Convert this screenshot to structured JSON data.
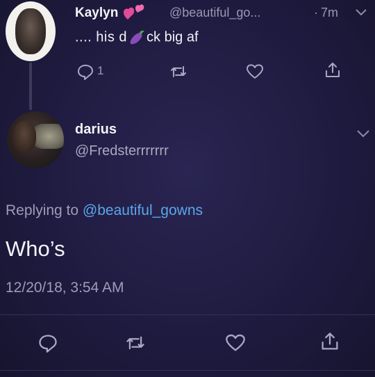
{
  "tweet_top": {
    "name": "Kaylyn",
    "handle": "@beautiful_go...",
    "separator": "·",
    "time": "7m",
    "text_before": ".... his d",
    "text_after": "ck big af",
    "reply_count": "1"
  },
  "tweet_main": {
    "name": "darius",
    "handle": "@Fredsterrrrrrr",
    "replying_prefix": "Replying to",
    "replying_to": "@beautiful_gowns",
    "text": "Who’s",
    "timestamp": "12/20/18, 3:54 AM"
  },
  "icons": [
    "reply-icon",
    "retweet-icon",
    "like-icon",
    "share-icon",
    "chevron-down-icon",
    "two-hearts-emoji",
    "eggplant-emoji"
  ],
  "colors": {
    "background": "#1f1b40",
    "link": "#5aa7ea",
    "secondary_text": "#9a98b4",
    "icon": "#a9a7c4"
  }
}
